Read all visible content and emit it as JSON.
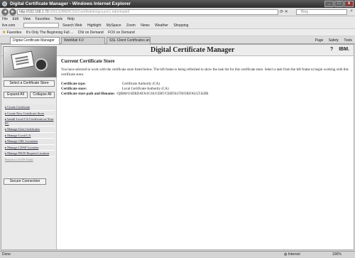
{
  "window": {
    "title": "Digital Certificate Manager - Windows Internet Explorer",
    "min": "_",
    "max": "□",
    "close": "x"
  },
  "address": {
    "url": "http://192.168.1.79",
    "url_tail": ":2001/QIBM/ICSS/Cert/Admin/qycucm1.ndm/main0",
    "back": "◄",
    "forward": "►",
    "search_placeholder": "Bing"
  },
  "menu": [
    "File",
    "Edit",
    "View",
    "Favorites",
    "Tools",
    "Help"
  ],
  "toolbar": {
    "left": "live.com",
    "search_web": "Search Web",
    "items": [
      "Highlight",
      "MySpace",
      "Zoom",
      "News",
      "Weather",
      "Shopping"
    ]
  },
  "favorites": {
    "label": "Favorites",
    "items": [
      "It's Only The Beginning Full ...",
      "CNr on Demand",
      "FOX on Demand"
    ]
  },
  "tabs": [
    {
      "label": "Digital Certificate Manager"
    },
    {
      "label": "WebMail 4.0"
    },
    {
      "label": "SSL Client Certificates and R..."
    }
  ],
  "tab_tools": [
    "Page",
    "Safety",
    "Tools"
  ],
  "header": {
    "title": "Digital Certificate Manager",
    "help": "?",
    "ibm": "IBM."
  },
  "leftnav": {
    "select_store": "Select a Certificate Store",
    "expand_all": "Expand All",
    "collapse_all": "Collapse All",
    "items": [
      "Create Certificate",
      "Create New Certificate Store",
      "Install Local CA Certificate on Your PC",
      "Manage User Certificates",
      "Manage Local CA",
      "Manage CRL Locations",
      "Manage LDAP Location",
      "Manage PKIX Request Location"
    ],
    "return": "Return to i5/OS Tasks",
    "secure_connection": "Secure Connection"
  },
  "main": {
    "heading": "Current Certificate Store",
    "description": "You have selected to work with the certificate store listed below. The left frame is being refreshed to show the task list for this certificate store. Select a task from the left frame to begin working with this certificate store.",
    "fields": [
      {
        "label": "Certificate type:",
        "value": "Certificate Authority (CA)"
      },
      {
        "label": "Certificate store:",
        "value": "Local Certificate Authority (CA)"
      },
      {
        "label": "Certificate store path and filename:",
        "value": "/QIBM/USERDATA/ICSS/CERT/CERTAUTH/DEFAULT.KDB"
      }
    ]
  },
  "status": {
    "left": "Done",
    "zone": "Internet",
    "zoom": "100%"
  }
}
